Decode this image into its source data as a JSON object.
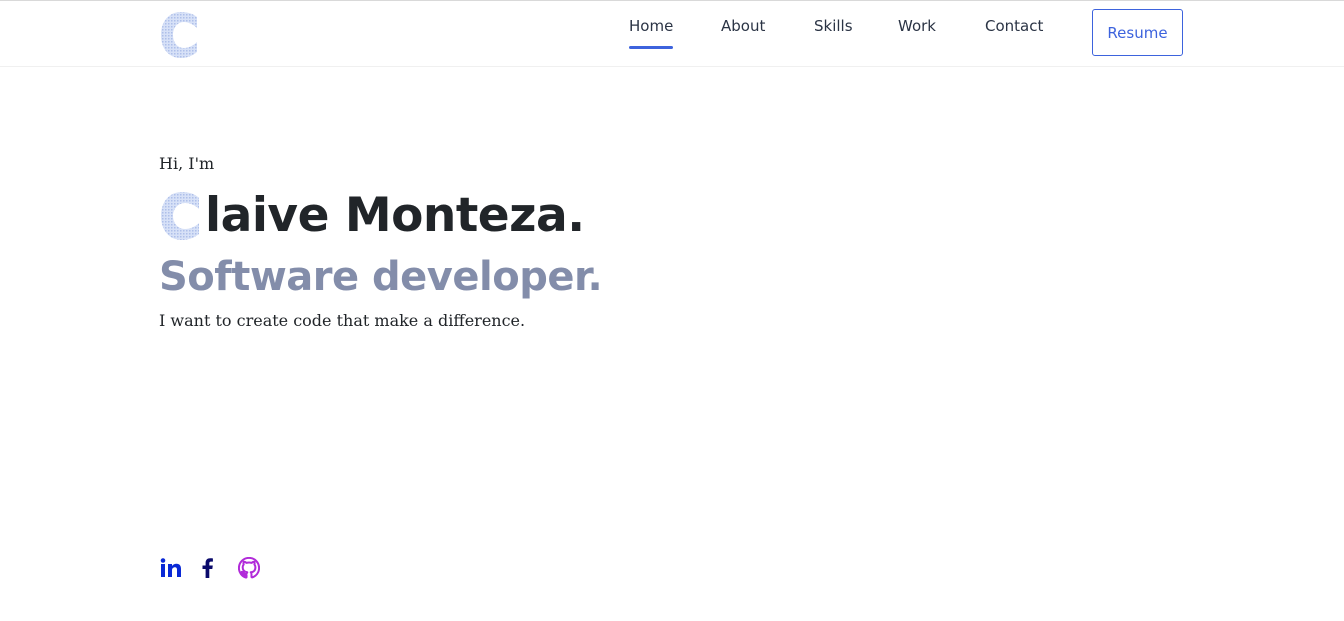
{
  "logo": {
    "letter": "C",
    "name": "logo-c-icon"
  },
  "nav": {
    "items": [
      {
        "label": "Home",
        "active": true
      },
      {
        "label": "About"
      },
      {
        "label": "Skills"
      },
      {
        "label": "Work"
      },
      {
        "label": "Contact"
      }
    ],
    "resume_label": "Resume"
  },
  "hero": {
    "greeting": "Hi, I'm",
    "name_initial": "C",
    "name_rest": "laive Monteza.",
    "role": "Software developer.",
    "tagline": "I want to create code that make a difference."
  },
  "socials": [
    {
      "icon": "linkedin-icon",
      "color": "#0a29d6"
    },
    {
      "icon": "facebook-icon",
      "color": "#0a0a6b"
    },
    {
      "icon": "github-icon",
      "color": "#b12bd9"
    }
  ],
  "colors": {
    "accent": "#3d63dd",
    "heading": "#212529",
    "role": "#838daa",
    "logo_fill": "#c9d6f3"
  }
}
